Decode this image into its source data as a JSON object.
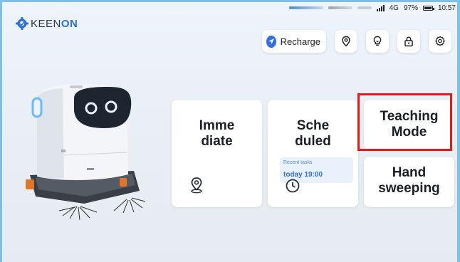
{
  "status_bar": {
    "network": "4G",
    "battery_percent": "97%",
    "time": "10:57"
  },
  "brand": {
    "logo_prefix": "KEEN",
    "logo_suffix": "ON"
  },
  "toolbar": {
    "recharge_label": "Recharge",
    "icons": [
      "location-pin-icon",
      "lightbulb-icon",
      "lock-icon",
      "settings-icon"
    ]
  },
  "modes": {
    "immediate": {
      "label_line1": "Imme",
      "label_line2": "diate",
      "icon": "location-pin-icon"
    },
    "scheduled": {
      "label_line1": "Sche",
      "label_line2": "duled",
      "icon": "clock-icon",
      "recent_tasks_label": "Recent tasks",
      "recent_task_time": "today 19:00"
    },
    "teaching": {
      "label_line1": "Teaching",
      "label_line2": "Mode",
      "highlighted": true
    },
    "hand_sweeping": {
      "label_line1": "Hand",
      "label_line2": "sweeping"
    }
  },
  "colors": {
    "accent": "#2f6fe0",
    "highlight": "#e01b1b",
    "robot_face": "#1d2530",
    "robot_eye": "#e8f4ff"
  }
}
